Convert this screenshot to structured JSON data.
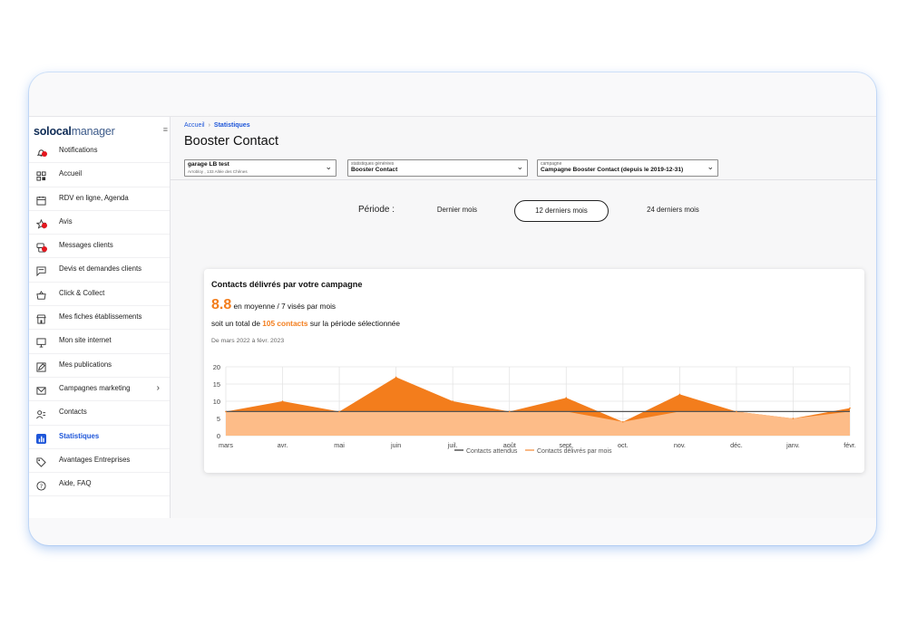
{
  "sidebar": {
    "brand_part1": "solocal",
    "brand_part2": "manager",
    "collapse_icon": "≡",
    "items": [
      {
        "label": "Notifications",
        "icon": "bell-icon",
        "badge": true
      },
      {
        "label": "Accueil",
        "icon": "grid-icon"
      },
      {
        "label": "RDV en ligne, Agenda",
        "icon": "calendar-icon"
      },
      {
        "label": "Avis",
        "icon": "star-icon",
        "badge": true
      },
      {
        "label": "Messages clients",
        "icon": "chat-icon",
        "badge": true
      },
      {
        "label": "Devis et demandes clients",
        "icon": "message-icon"
      },
      {
        "label": "Click & Collect",
        "icon": "basket-icon"
      },
      {
        "label": "Mes fiches établissements",
        "icon": "store-icon"
      },
      {
        "label": "Mon site internet",
        "icon": "monitor-icon"
      },
      {
        "label": "Mes publications",
        "icon": "edit-icon"
      },
      {
        "label": "Campagnes marketing",
        "icon": "mail-icon",
        "chevron": "›"
      },
      {
        "label": "Contacts",
        "icon": "contacts-icon"
      },
      {
        "label": "Statistiques",
        "icon": "stats-icon",
        "active": true
      },
      {
        "label": "Avantages Entreprises",
        "icon": "tag-icon"
      },
      {
        "label": "Aide, FAQ",
        "icon": "help-icon"
      }
    ]
  },
  "breadcrumb": {
    "home": "Accueil",
    "separator": "›",
    "current": "Statistiques"
  },
  "page_title": "Booster Contact",
  "selects": {
    "establishment": {
      "value": "garage LB test",
      "sub": "Arrobloy , 133 Allée des Chênes"
    },
    "stats": {
      "caption": "statistiques générées",
      "value": "Booster Contact"
    },
    "campaign": {
      "caption": "campagne",
      "value": "Campagne Booster Contact (depuis le 2019-12-31)"
    },
    "arrow": "⌄"
  },
  "period": {
    "label": "Période :",
    "options": [
      "Dernier mois",
      "12 derniers mois",
      "24 derniers mois"
    ],
    "selected": "12 derniers mois"
  },
  "card": {
    "title": "Contacts délivrés par votre campagne",
    "avg_value": "8.8",
    "avg_text": " en moyenne / 7 visés par mois",
    "total_prefix": "soit un total de ",
    "total_highlight": "105 contacts",
    "total_suffix": " sur la période sélectionnée",
    "range": "De mars 2022 à févr. 2023"
  },
  "colors": {
    "accent": "#f37d1c",
    "light_orange": "#fdbc88",
    "primary": "#1e56d9"
  },
  "chart_data": {
    "type": "area",
    "categories": [
      "mars",
      "avr.",
      "mai",
      "juin",
      "juil.",
      "août",
      "sept.",
      "oct.",
      "nov.",
      "déc.",
      "janv.",
      "févr."
    ],
    "series": [
      {
        "name": "Contacts attendus",
        "values": [
          7,
          7,
          7,
          7,
          7,
          7,
          7,
          7,
          7,
          7,
          7,
          7
        ],
        "color": "#555555"
      },
      {
        "name": "Contacts délivrés par mois",
        "values": [
          7,
          10,
          7,
          17,
          10,
          7,
          11,
          4,
          12,
          7,
          5,
          8
        ],
        "color": "#f37d1c"
      }
    ],
    "ylim": [
      0,
      20
    ],
    "yticks": [
      0,
      5,
      10,
      15,
      20
    ],
    "grid": true,
    "legend": "bottom"
  }
}
